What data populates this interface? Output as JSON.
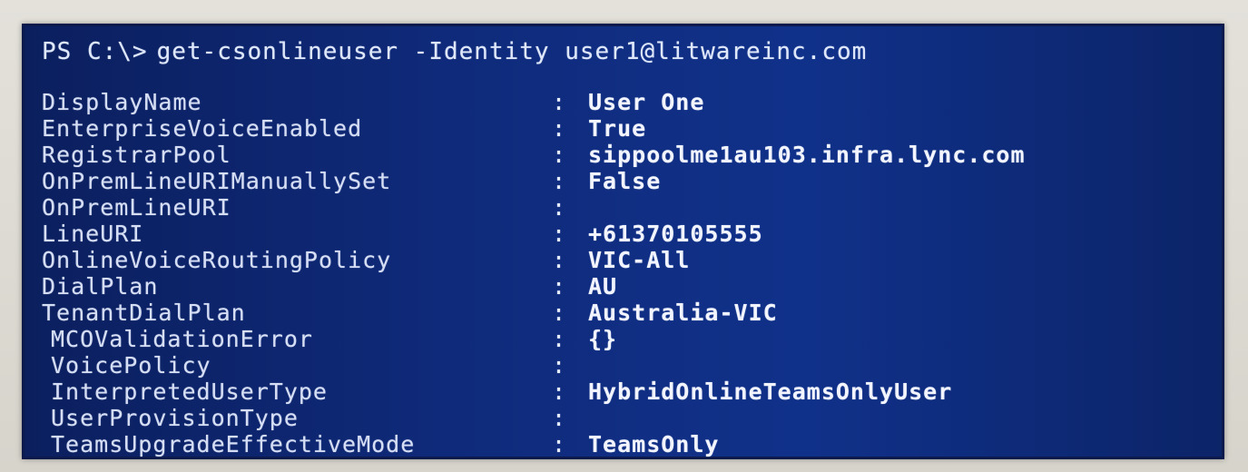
{
  "prompt": {
    "ps": "PS C:\\>",
    "command": "get-csonlineuser -Identity user1@litwareinc.com"
  },
  "rows": [
    {
      "key": "DisplayName",
      "sep": ":",
      "value": "User One"
    },
    {
      "key": "EnterpriseVoiceEnabled",
      "sep": ":",
      "value": "True"
    },
    {
      "key": "RegistrarPool",
      "sep": ":",
      "value": "sippoolme1au103.infra.lync.com"
    },
    {
      "key": "OnPremLineURIManuallySet",
      "sep": ":",
      "value": "False"
    },
    {
      "key": "OnPremLineURI",
      "sep": ":",
      "value": ""
    },
    {
      "key": "LineURI",
      "sep": ":",
      "value": "+61370105555"
    },
    {
      "key": "OnlineVoiceRoutingPolicy",
      "sep": ":",
      "value": "VIC-All"
    },
    {
      "key": "DialPlan",
      "sep": ":",
      "value": "AU"
    },
    {
      "key": "TenantDialPlan",
      "sep": ":",
      "value": "Australia-VIC"
    },
    {
      "key": "MCOValidationError",
      "sep": ":",
      "value": "{}"
    },
    {
      "key": "VoicePolicy",
      "sep": ":",
      "value": ""
    },
    {
      "key": "InterpretedUserType",
      "sep": ":",
      "value": "HybridOnlineTeamsOnlyUser"
    },
    {
      "key": "UserProvisionType",
      "sep": ":",
      "value": ""
    },
    {
      "key": "TeamsUpgradeEffectiveMode",
      "sep": ":",
      "value": "TeamsOnly"
    }
  ]
}
